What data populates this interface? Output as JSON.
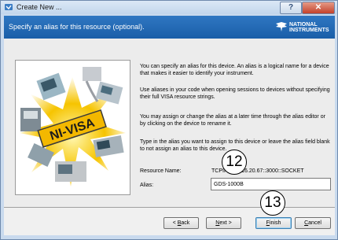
{
  "window": {
    "title": "Create New ...",
    "help_label": "?",
    "close_label": "✕"
  },
  "header": {
    "subtitle": "Specify an alias for this resource (optional).",
    "logo_line1": "NATIONAL",
    "logo_line2": "INSTRUMENTS"
  },
  "body": {
    "paragraphs": [
      "You can specify an alias for this device. An alias is a logical name for a device that makes it easier to identify your instrument.",
      "Use aliases in your code when opening sessions to devices without specifying their full VISA resource strings.",
      "You may assign or change the alias at a later time through the alias editor or by clicking on the device to rename it.",
      "Type in the alias you want to assign to this device or leave the alias field blank to not assign an alias to this device."
    ],
    "resource_label": "Resource Name:",
    "resource_value": "TCPIP::172.16.20.67::3000::SOCKET",
    "alias_label": "Alias:",
    "alias_value": "GDS-1000B"
  },
  "illustration": {
    "banner_text": "NI-VISA"
  },
  "callouts": {
    "c12": "12",
    "c13": "13"
  },
  "buttons": {
    "back_prefix": "< ",
    "back_key": "B",
    "back_rest": "ack",
    "next_key": "N",
    "next_rest": "ext >",
    "finish_key": "F",
    "finish_rest": "inish",
    "cancel_key": "C",
    "cancel_rest": "ancel"
  }
}
